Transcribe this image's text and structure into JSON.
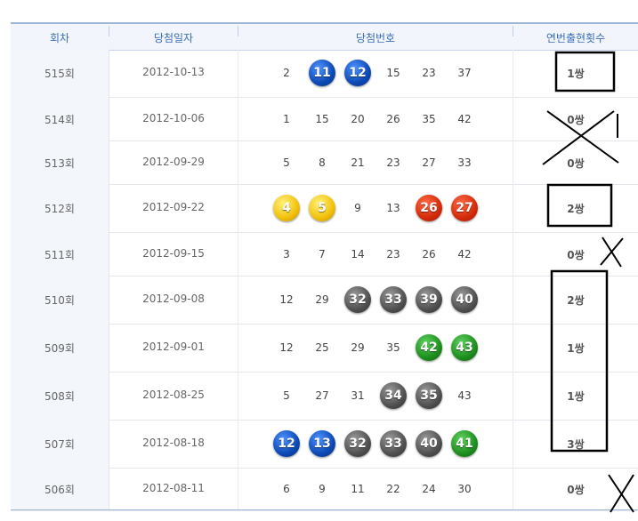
{
  "header": {
    "round": "회차",
    "date": "당첨일자",
    "numbers": "당첨번호",
    "consecutive": "연번출현횟수"
  },
  "rows": [
    {
      "round": "515회",
      "date": "2012-10-13",
      "nums": [
        2,
        11,
        12,
        15,
        23,
        37
      ],
      "colored": [
        false,
        true,
        true,
        false,
        false,
        false
      ],
      "count": "1쌍"
    },
    {
      "round": "514회",
      "date": "2012-10-06",
      "nums": [
        1,
        15,
        20,
        26,
        35,
        42
      ],
      "colored": [
        false,
        false,
        false,
        false,
        false,
        false
      ],
      "count": "0쌍"
    },
    {
      "round": "513회",
      "date": "2012-09-29",
      "nums": [
        5,
        8,
        21,
        23,
        27,
        33
      ],
      "colored": [
        false,
        false,
        false,
        false,
        false,
        false
      ],
      "count": "0쌍"
    },
    {
      "round": "512회",
      "date": "2012-09-22",
      "nums": [
        4,
        5,
        9,
        13,
        26,
        27
      ],
      "colored": [
        true,
        true,
        false,
        false,
        true,
        true
      ],
      "count": "2쌍"
    },
    {
      "round": "511회",
      "date": "2012-09-15",
      "nums": [
        3,
        7,
        14,
        23,
        26,
        42
      ],
      "colored": [
        false,
        false,
        false,
        false,
        false,
        false
      ],
      "count": "0쌍"
    },
    {
      "round": "510회",
      "date": "2012-09-08",
      "nums": [
        12,
        29,
        32,
        33,
        39,
        40
      ],
      "colored": [
        false,
        false,
        true,
        true,
        true,
        true
      ],
      "count": "2쌍"
    },
    {
      "round": "509회",
      "date": "2012-09-01",
      "nums": [
        12,
        25,
        29,
        35,
        42,
        43
      ],
      "colored": [
        false,
        false,
        false,
        false,
        true,
        true
      ],
      "count": "1쌍"
    },
    {
      "round": "508회",
      "date": "2012-08-25",
      "nums": [
        5,
        27,
        31,
        34,
        35,
        43
      ],
      "colored": [
        false,
        false,
        false,
        true,
        true,
        false
      ],
      "count": "1쌍"
    },
    {
      "round": "507회",
      "date": "2012-08-18",
      "nums": [
        12,
        13,
        32,
        33,
        40,
        41
      ],
      "colored": [
        true,
        true,
        true,
        true,
        true,
        true
      ],
      "count": "3쌍"
    },
    {
      "round": "506회",
      "date": "2012-08-11",
      "nums": [
        6,
        9,
        11,
        22,
        24,
        30
      ],
      "colored": [
        false,
        false,
        false,
        false,
        false,
        false
      ],
      "count": "0쌍"
    }
  ],
  "ball_colors": {
    "yellow": "#f1c10a",
    "blue": "#0d49b5",
    "red": "#d42b0a",
    "gray": "#505050",
    "green": "#1e8f1e"
  },
  "header_color": "#3b6db7"
}
